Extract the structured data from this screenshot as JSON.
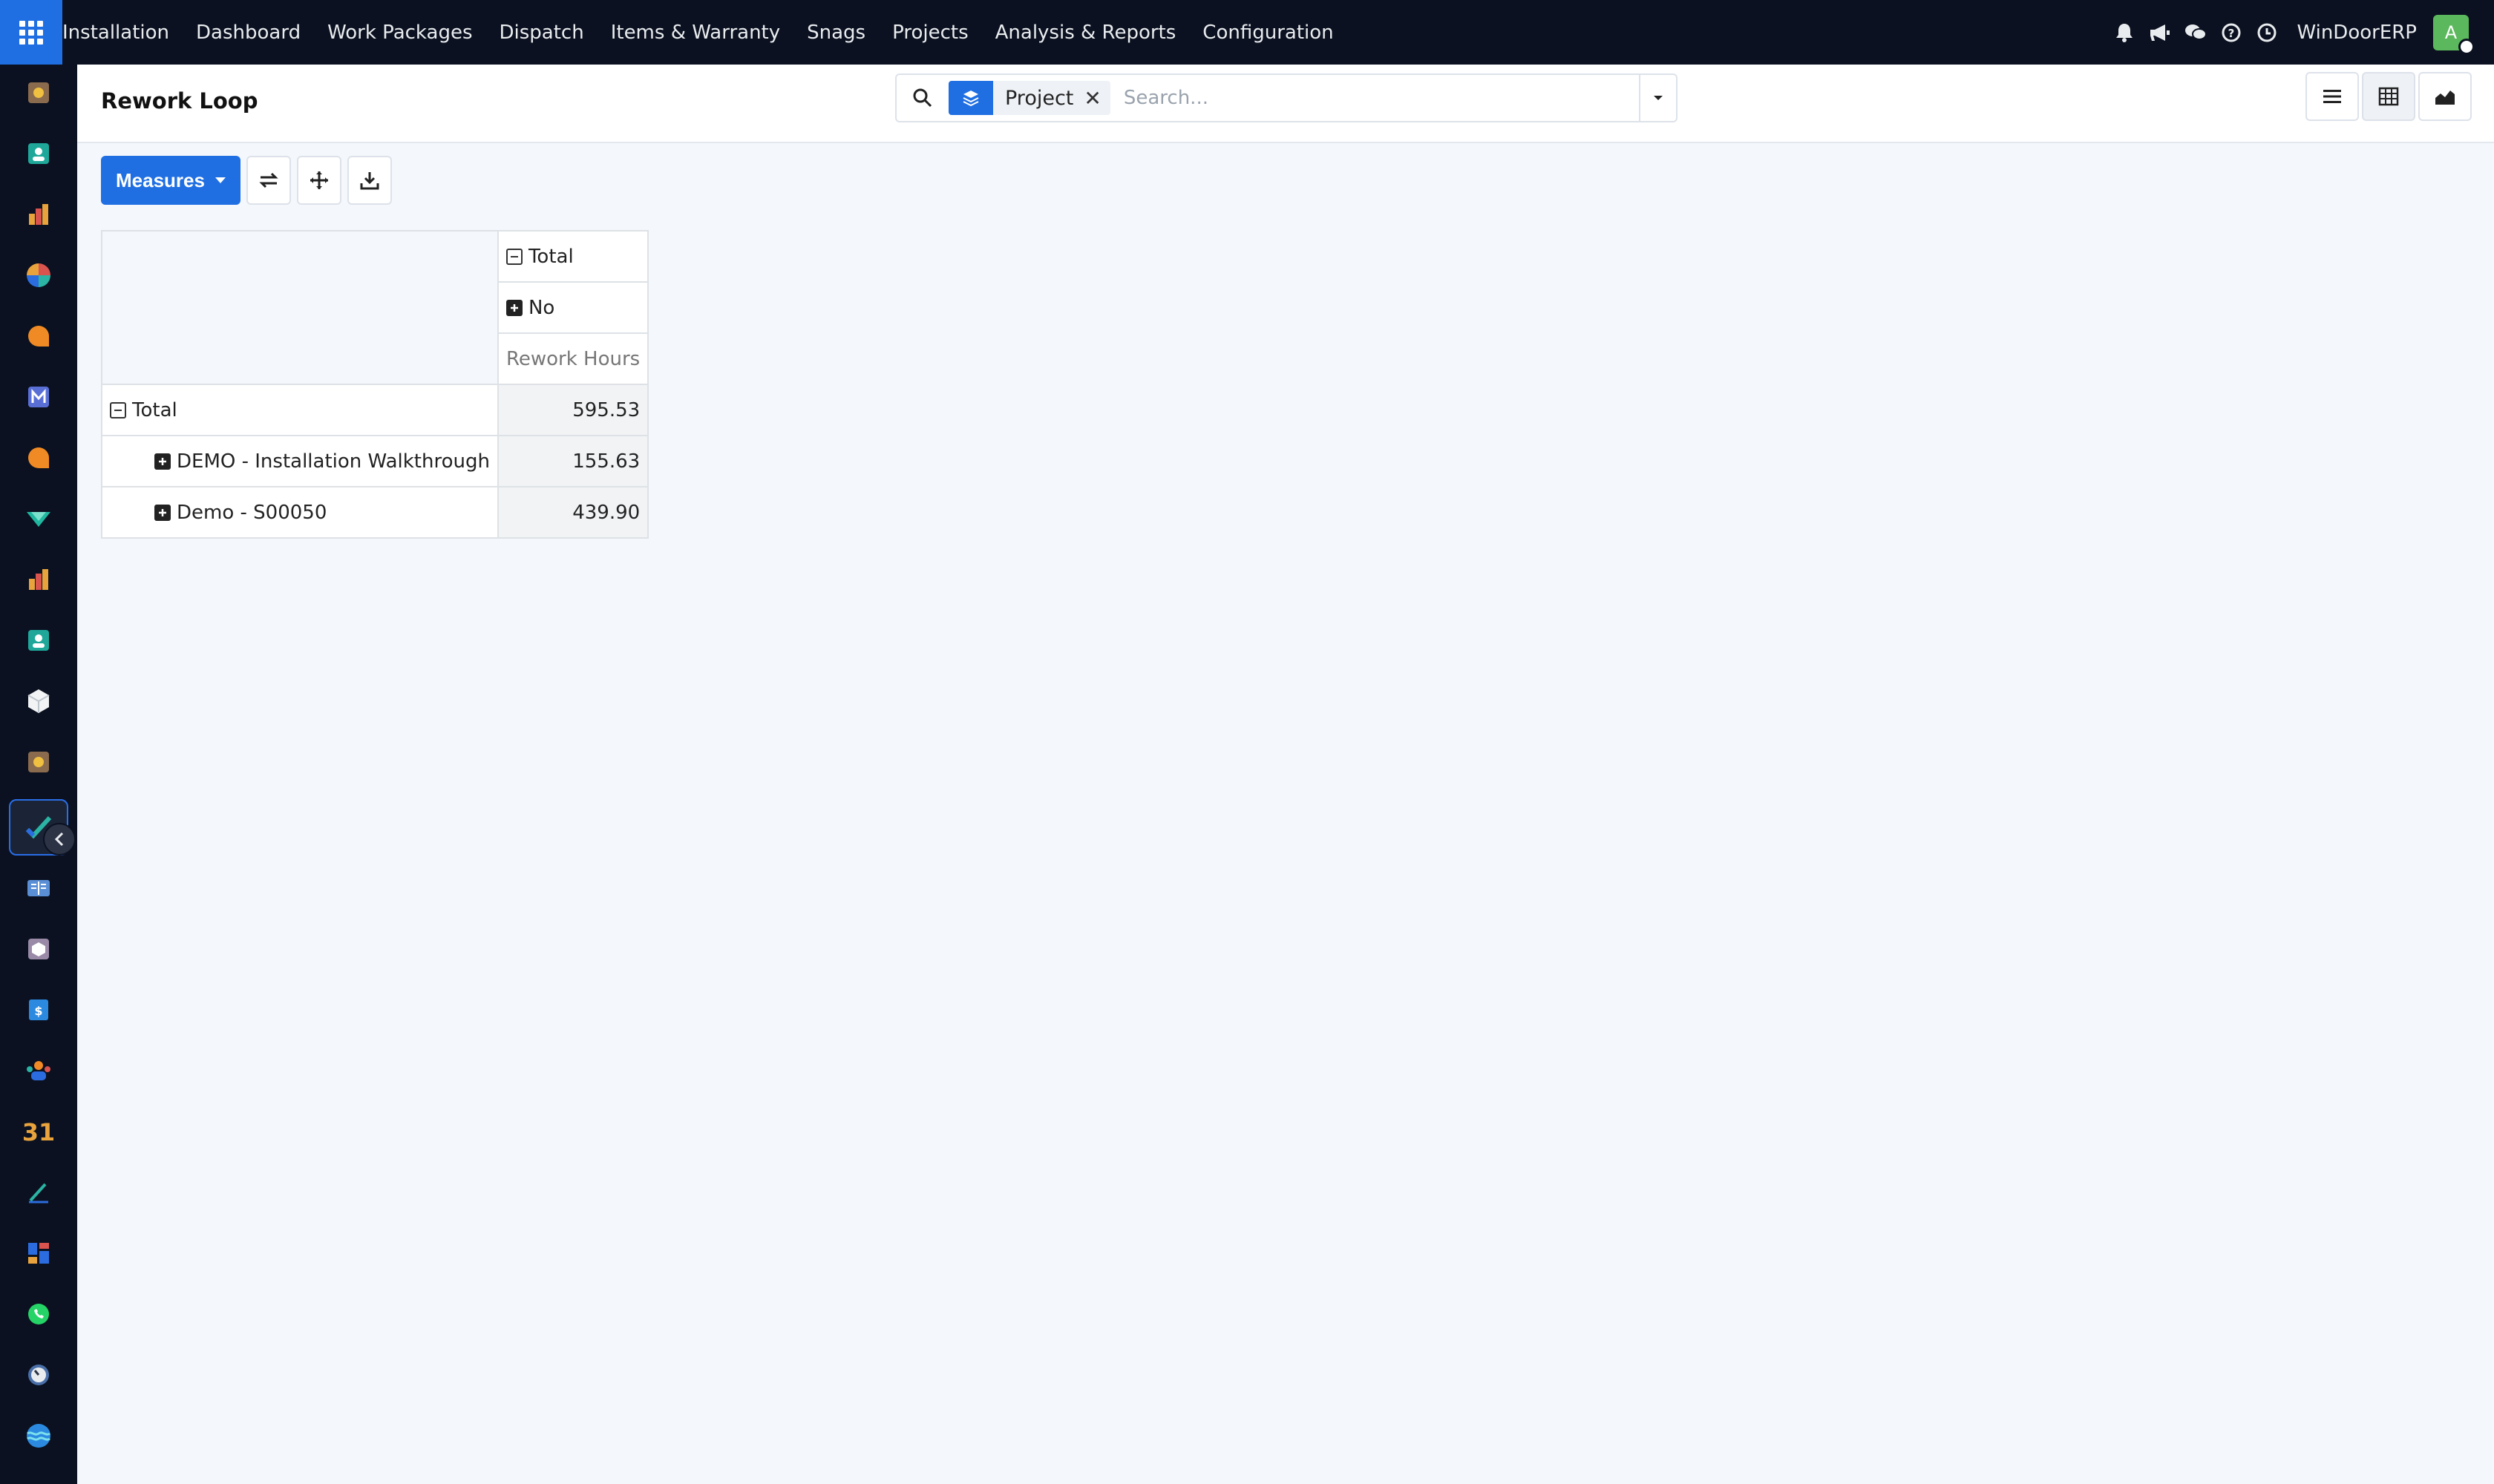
{
  "topbar": {
    "menu": [
      "Installation",
      "Dashboard",
      "Work Packages",
      "Dispatch",
      "Items & Warranty",
      "Snags",
      "Projects",
      "Analysis & Reports",
      "Configuration"
    ],
    "company": "WinDoorERP",
    "avatar_letter": "A",
    "icons": [
      "bell-icon",
      "megaphone-icon",
      "chat-icon",
      "help-icon",
      "clock-icon"
    ]
  },
  "control_panel": {
    "title": "Rework Loop",
    "search": {
      "facet_label": "Project",
      "facet_remove": "✕",
      "placeholder": "Search..."
    }
  },
  "toolbar": {
    "measures_label": "Measures"
  },
  "pivot": {
    "col_total": "Total",
    "col_group": "No",
    "measure": "Rework Hours",
    "rows": [
      {
        "label": "Total",
        "value": "595.53"
      },
      {
        "label": "DEMO - Installation Walkthrough",
        "value": "155.63"
      },
      {
        "label": "Demo - S00050",
        "value": "439.90"
      }
    ]
  },
  "colors": {
    "navbar": "#0b1120",
    "primary": "#1f6fe3",
    "background": "#f4f7fb"
  }
}
